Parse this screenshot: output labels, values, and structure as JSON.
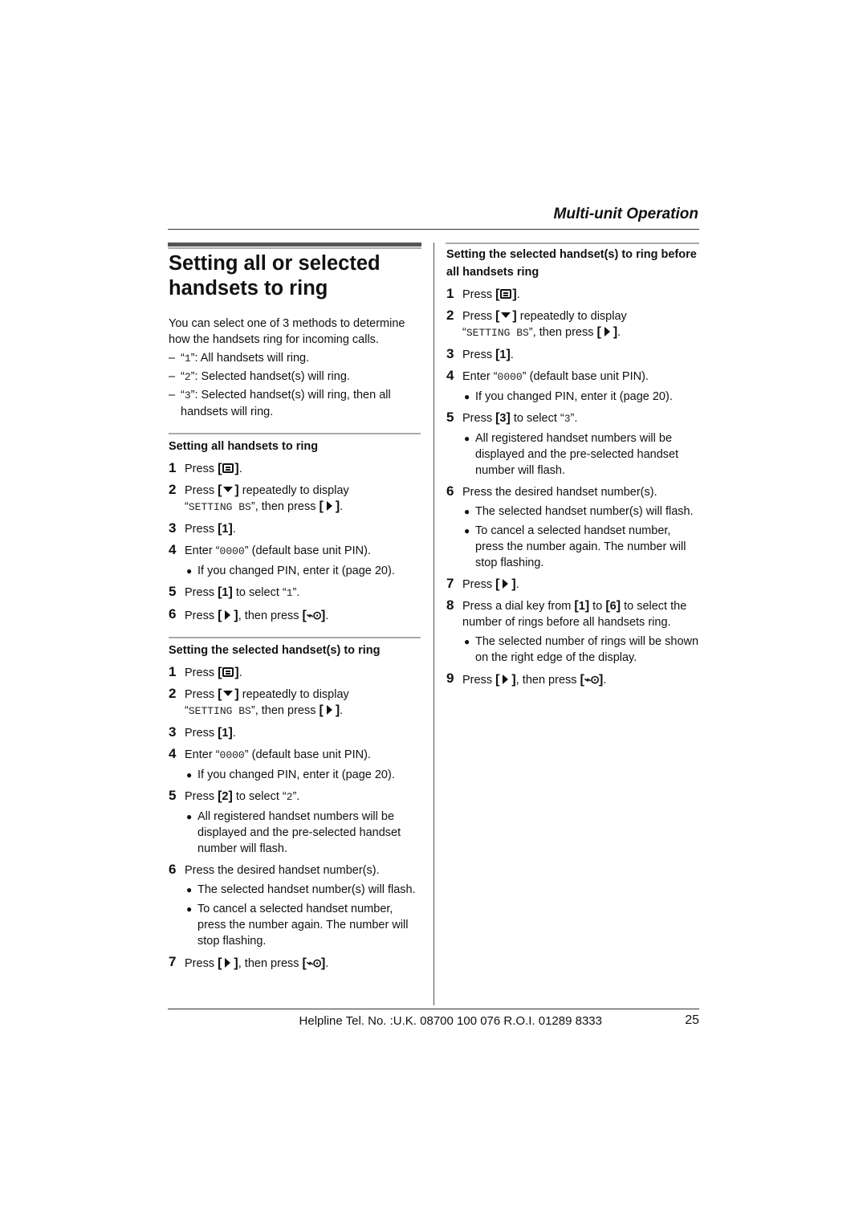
{
  "header": {
    "section": "Multi-unit Operation"
  },
  "title": {
    "line1": "Setting all or selected",
    "line2": "handsets to ring"
  },
  "intro": {
    "text": "You can select one of 3 methods to determine how the handsets ring for incoming calls.",
    "options": [
      {
        "dash": "–",
        "code": "1",
        "text": ": All handsets will ring."
      },
      {
        "dash": "–",
        "code": "2",
        "text": ": Selected handset(s) will ring."
      },
      {
        "dash": "–",
        "code": "3",
        "text": ": Selected handset(s) will ring, then all handsets will ring."
      }
    ]
  },
  "keys": {
    "menu": "menu-key",
    "down": "down-key",
    "right": "right-key",
    "off": "off-key",
    "off_glyph": "⌁⊙",
    "one": "1",
    "two": "2",
    "three": "3",
    "six": "6"
  },
  "common": {
    "press": "Press ",
    "period": ".",
    "repeatedly": " repeatedly to display",
    "setting_bs": "SETTING BS",
    "then_press": ", then press ",
    "enter": "Enter ",
    "pin": "0000",
    "pin_suffix": " (default base unit PIN).",
    "changed_pin": "If you changed PIN, enter it (page 20).",
    "to_select": " to select ",
    "q_open": "“",
    "q_close": "”",
    "bullet": "●"
  },
  "section_all": {
    "heading": "Setting all handsets to ring",
    "steps": [
      "1",
      "2",
      "3",
      "4",
      "5",
      "6"
    ],
    "select_code": "1"
  },
  "section_selected": {
    "heading": "Setting the selected handset(s) to ring",
    "steps": [
      "1",
      "2",
      "3",
      "4",
      "5",
      "6",
      "7"
    ],
    "select_code": "2",
    "b5": "All registered handset numbers will be displayed and the pre-selected handset number will flash.",
    "s6": "Press the desired handset number(s).",
    "b6a": "The selected handset number(s) will flash.",
    "b6b": "To cancel a selected handset number, press the number again. The number will stop flashing."
  },
  "section_before": {
    "heading": "Setting the selected handset(s) to ring before all handsets ring",
    "steps": [
      "1",
      "2",
      "3",
      "4",
      "5",
      "6",
      "7",
      "8",
      "9"
    ],
    "select_code": "3",
    "b5": "All registered handset numbers will be displayed and the pre-selected handset number will flash.",
    "s6": "Press the desired handset number(s).",
    "b6a": "The selected handset number(s) will flash.",
    "b6b": "To cancel a selected handset number, press the number again. The number will stop flashing.",
    "s8_a": "Press a dial key from ",
    "s8_b": " to ",
    "s8_c": " to select the number of rings before all handsets ring.",
    "b8": "The selected number of rings will be shown on the right edge of the display."
  },
  "footer": {
    "helpline": "Helpline Tel. No. :U.K. 08700 100 076  R.O.I. 01289 8333",
    "page": "25"
  }
}
